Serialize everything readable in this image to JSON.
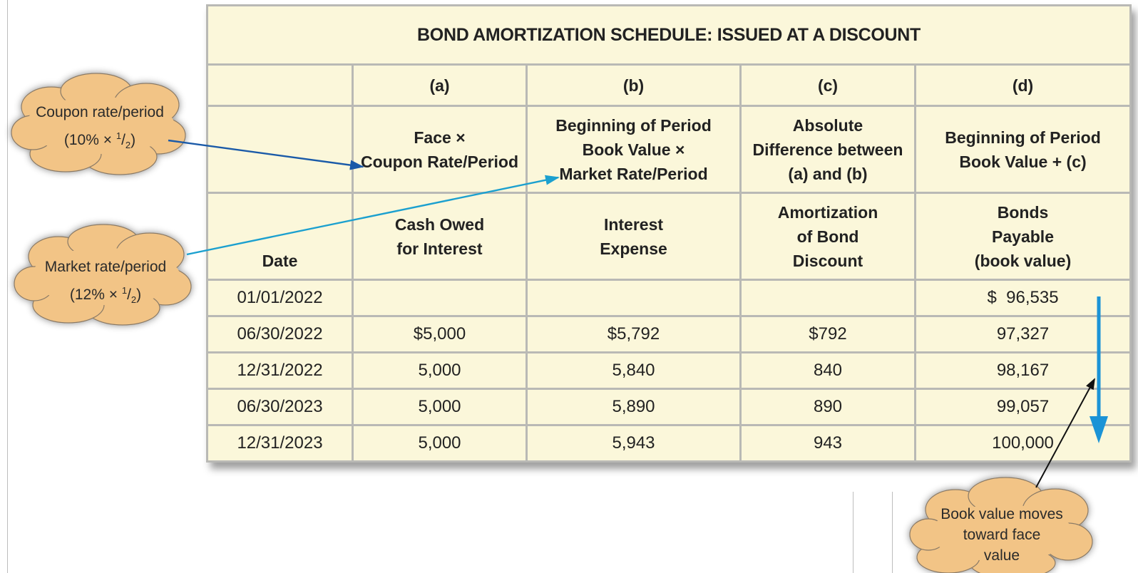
{
  "table": {
    "title": "BOND AMORTIZATION SCHEDULE: ISSUED AT A DISCOUNT",
    "column_letters": [
      "",
      "(a)",
      "(b)",
      "(c)",
      "(d)"
    ],
    "formulas": [
      [],
      [
        "Face ×",
        "Coupon Rate/Period"
      ],
      [
        "Beginning of Period",
        "Book Value ×",
        "Market Rate/Period"
      ],
      [
        "Absolute",
        "Difference between",
        "(a) and (b)"
      ],
      [
        "Beginning of Period",
        "Book Value + (c)"
      ]
    ],
    "headers": [
      [
        "Date"
      ],
      [
        "Cash Owed",
        "for Interest"
      ],
      [
        "Interest",
        "Expense"
      ],
      [
        "Amortization",
        "of Bond",
        "Discount"
      ],
      [
        "Bonds",
        "Payable",
        "(book value)"
      ]
    ],
    "rows": [
      [
        "01/01/2022",
        "",
        "",
        "",
        "$  96,535"
      ],
      [
        "06/30/2022",
        "$5,000",
        "$5,792",
        "$792",
        "97,327"
      ],
      [
        "12/31/2022",
        "5,000",
        "5,840",
        "840",
        "98,167"
      ],
      [
        "06/30/2023",
        "5,000",
        "5,890",
        "890",
        "99,057"
      ],
      [
        "12/31/2023",
        "5,000",
        "5,943",
        "943",
        "100,000"
      ]
    ]
  },
  "callouts": {
    "coupon": {
      "line1": "Coupon rate/period",
      "line2_pre": "(10% × ",
      "num": "1",
      "den": "2",
      "line2_post": ")"
    },
    "market": {
      "line1": "Market rate/period",
      "line2_pre": "(12% × ",
      "num": "1",
      "den": "2",
      "line2_post": ")"
    },
    "book": {
      "line1": "Book value moves",
      "line2": "toward face",
      "line3": "value"
    }
  },
  "colors": {
    "table_fill": "#fbf7da",
    "grid": "#b9b9b5",
    "cloud_fill": "#f2c486",
    "coupon_arrow": "#1a5aa8",
    "market_arrow": "#1ba0cf",
    "book_arrow": "#1b93d6"
  }
}
